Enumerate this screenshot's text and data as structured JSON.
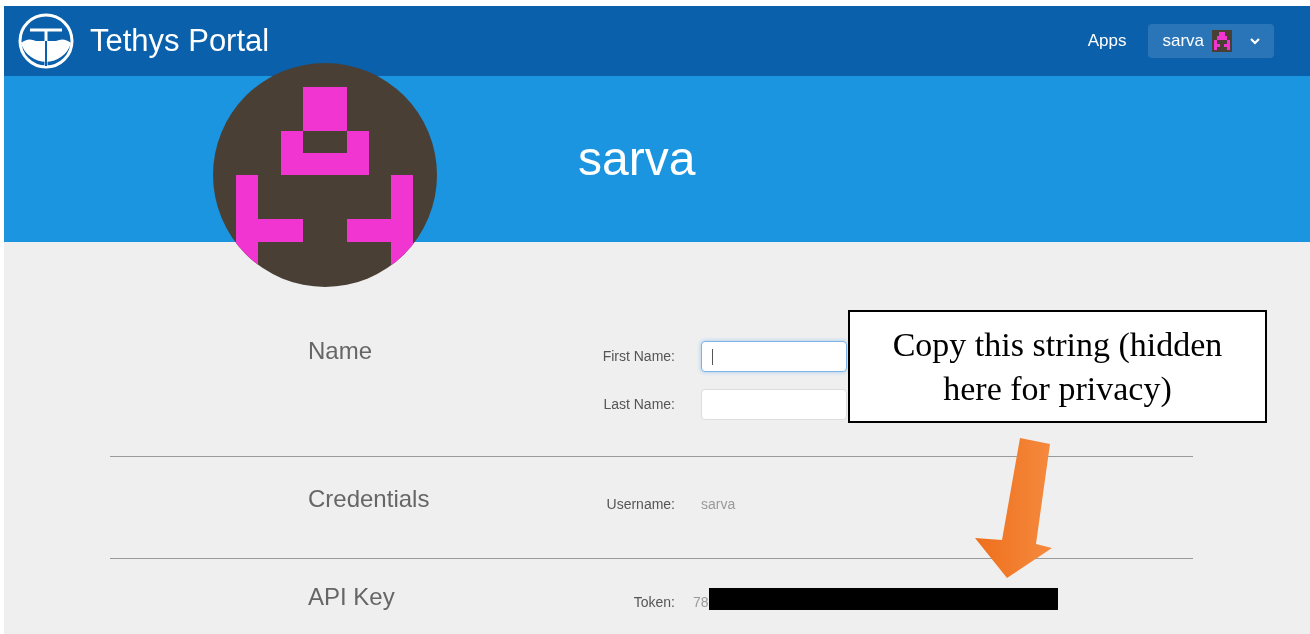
{
  "navbar": {
    "brand": "Tethys Portal",
    "links": [
      {
        "label": "Apps"
      }
    ],
    "user_menu": {
      "label": "sarva"
    }
  },
  "profile": {
    "username": "sarva"
  },
  "sections": [
    {
      "title": "Name",
      "fields": [
        {
          "kind": "input",
          "label": "First Name:",
          "focused": true
        },
        {
          "kind": "input",
          "label": "Last Name:",
          "focused": false
        }
      ]
    },
    {
      "title": "Credentials",
      "fields": [
        {
          "kind": "text",
          "label": "Username:",
          "value": "sarva"
        }
      ]
    },
    {
      "title": "API Key",
      "fields": [
        {
          "kind": "redacted",
          "label": "Token:",
          "value": "78"
        }
      ]
    }
  ],
  "annotation": {
    "text": "Copy this string (hidden here for privacy)"
  }
}
